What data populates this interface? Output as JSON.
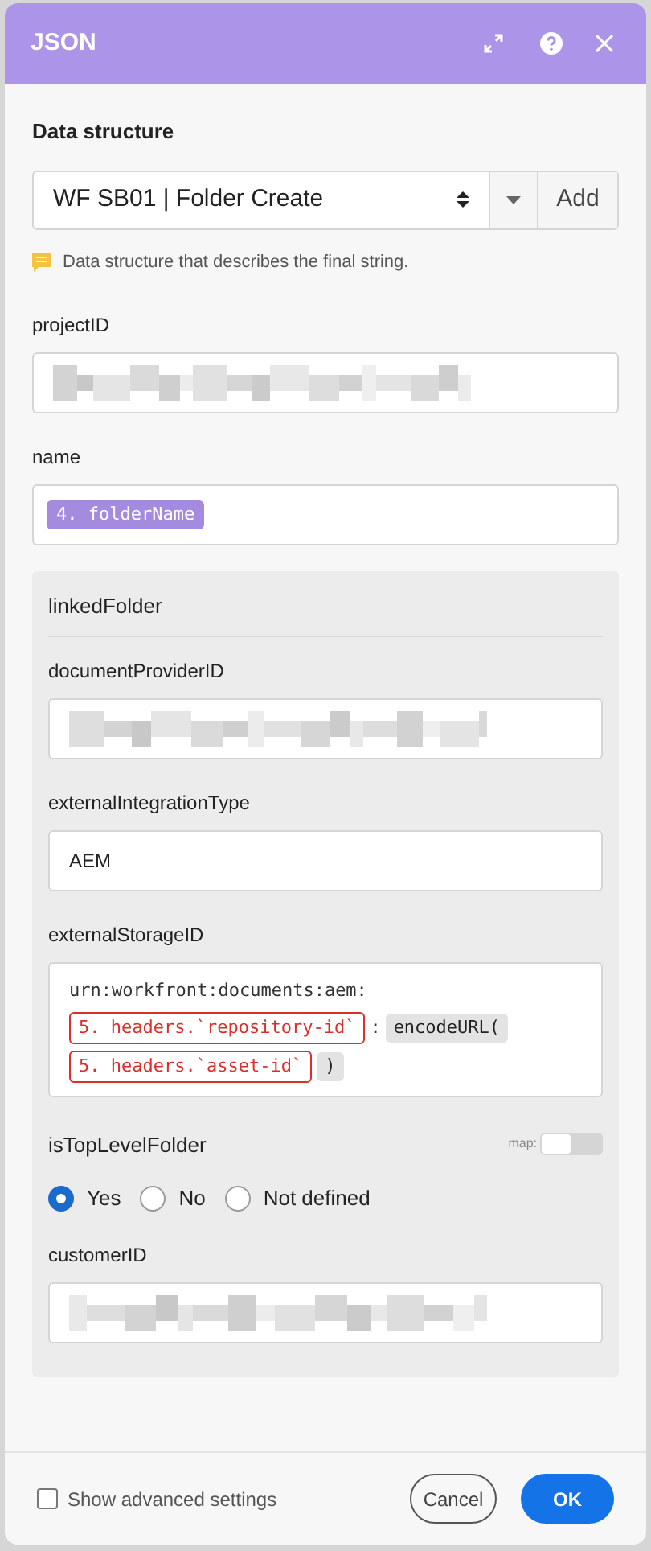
{
  "window": {
    "title": "JSON"
  },
  "data_structure": {
    "label": "Data structure",
    "value": "WF SB01 | Folder Create",
    "add_button": "Add",
    "hint": "Data structure that describes the final string."
  },
  "fields": [
    {
      "kind": "redacted",
      "label": "projectID"
    },
    {
      "kind": "tokens",
      "label": "name",
      "tokens": [
        {
          "kind": "variable",
          "text": "4. folderName"
        }
      ]
    }
  ],
  "group": {
    "title": "linkedFolder",
    "fields": [
      {
        "kind": "redacted",
        "label": "documentProviderID"
      },
      {
        "kind": "text",
        "label": "externalIntegrationType",
        "value": "AEM"
      },
      {
        "kind": "template",
        "label": "externalStorageID",
        "lines": [
          [
            {
              "kind": "text",
              "text": "urn:workfront:documents:aem:"
            }
          ],
          [
            {
              "kind": "error",
              "text": "5. headers.`repository-id`"
            },
            {
              "kind": "text",
              "text": ":"
            },
            {
              "kind": "function",
              "text": "encodeURL("
            }
          ],
          [
            {
              "kind": "error",
              "text": "5. headers.`asset-id`"
            },
            {
              "kind": "function",
              "text": ")"
            }
          ]
        ]
      },
      {
        "kind": "radio",
        "label": "isTopLevelFolder",
        "map": {
          "label": "map:",
          "on": false
        },
        "options": [
          {
            "label": "Yes",
            "selected": true
          },
          {
            "label": "No",
            "selected": false
          },
          {
            "label": "Not defined",
            "selected": false
          }
        ]
      },
      {
        "kind": "redacted",
        "label": "customerID"
      }
    ]
  },
  "footer": {
    "advanced": {
      "label": "Show advanced settings",
      "checked": false
    },
    "buttons": [
      {
        "kind": "secondary",
        "label": "Cancel"
      },
      {
        "kind": "primary",
        "label": "OK"
      }
    ]
  }
}
